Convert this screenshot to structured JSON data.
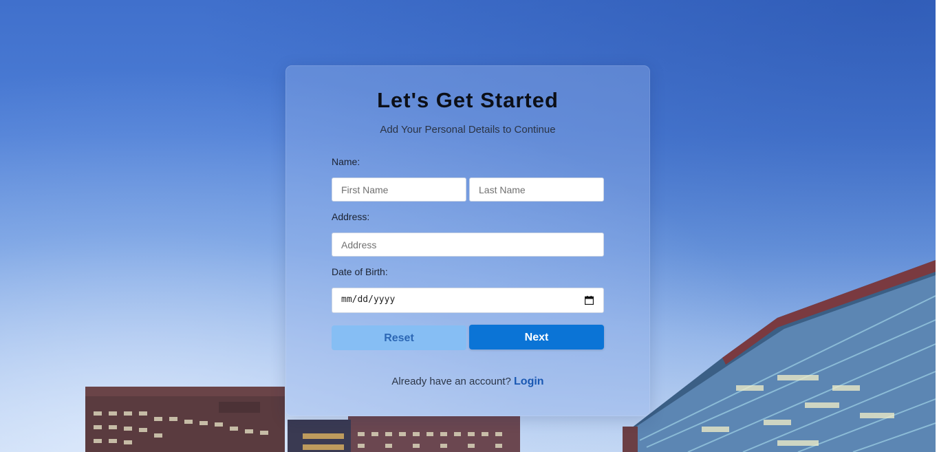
{
  "form": {
    "title": "Let's Get Started",
    "subtitle": "Add Your Personal Details to Continue",
    "name_label": "Name:",
    "first_name_placeholder": "First Name",
    "last_name_placeholder": "Last Name",
    "address_label": "Address:",
    "address_placeholder": "Address",
    "dob_label": "Date of Birth:",
    "dob_placeholder": "mm/dd/yyyy",
    "reset_label": "Reset",
    "next_label": "Next",
    "footer_text": "Already have an account?",
    "login_label": "Login"
  },
  "icons": {
    "date_picker": "calendar-icon"
  },
  "colors": {
    "next_button": "#0b74d6",
    "reset_button": "#86bef4",
    "login_link": "#1a58b3"
  }
}
